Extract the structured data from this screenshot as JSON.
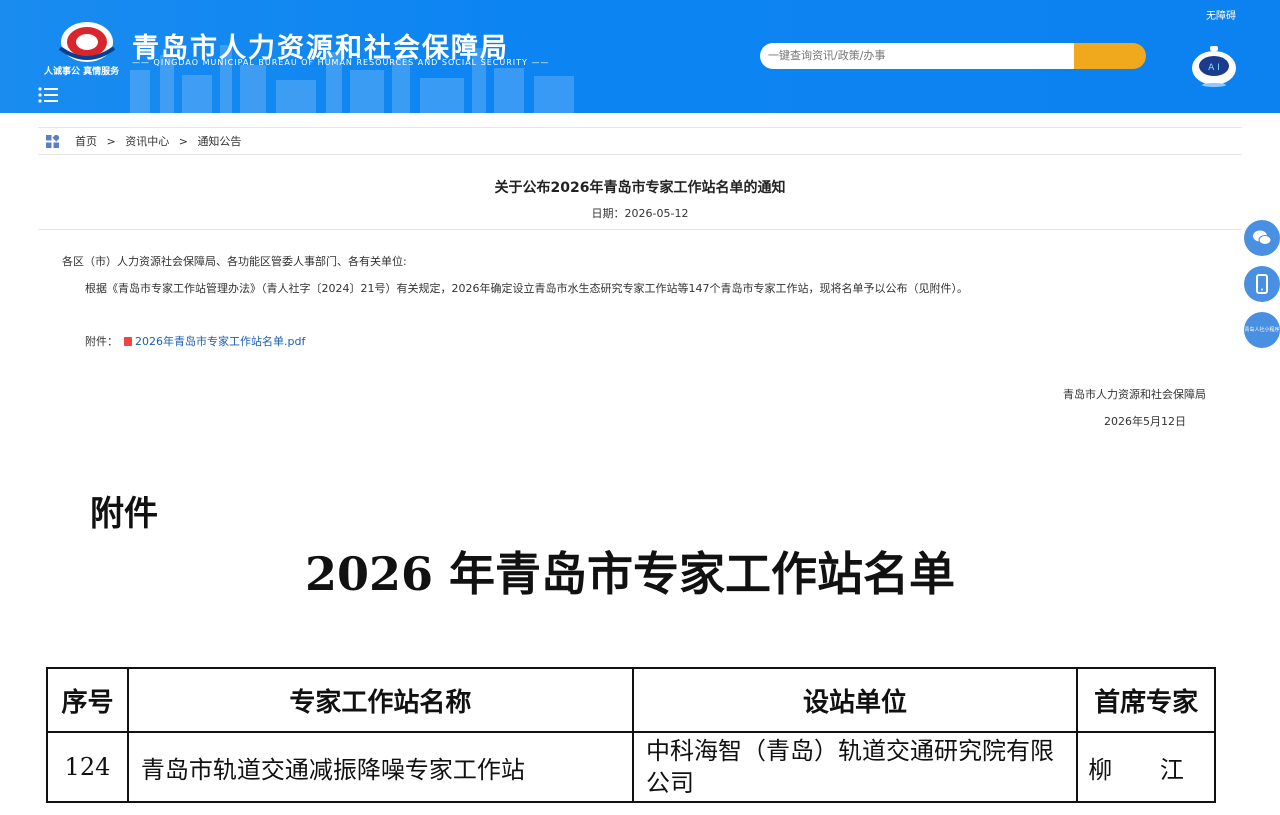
{
  "header": {
    "site_title": "青岛市人力资源和社会保障局",
    "site_subtitle": "—— QINGDAO MUNICIPAL BUREAU OF HUMAN RESOURCES AND SOCIAL SECURITY ——",
    "logo_slogan": "人诚事公 真情服务",
    "accessibility": "无障碍",
    "search_placeholder": "一键查询资讯/政策/办事"
  },
  "breadcrumb": [
    "首页",
    ">",
    "资讯中心",
    ">",
    "通知公告"
  ],
  "article": {
    "title": "关于公布2026年青岛市专家工作站名单的通知",
    "date": "日期：2026-05-12",
    "salutation": "各区（市）人力资源社会保障局、各功能区管委人事部门、各有关单位:",
    "paragraph": "根据《青岛市专家工作站管理办法》（青人社字〔2024〕21号）有关规定，2026年确定设立青岛市水生态研究专家工作站等147个青岛市专家工作站，现将名单予以公布（见附件）。",
    "attachment_label": "附件：",
    "attachment_link": "2026年青岛市专家工作站名单.pdf",
    "signer": "青岛市人力资源和社会保障局",
    "sign_date": "2026年5月12日"
  },
  "side_buttons": {
    "miniprogram": "青岛人社小程序"
  },
  "annex": {
    "label": "附件",
    "title": "2026 年青岛市专家工作站名单",
    "headers": [
      "序号",
      "专家工作站名称",
      "设站单位",
      "首席专家"
    ],
    "rows": [
      {
        "no": "124",
        "name": "青岛市轨道交通减振降噪专家工作站",
        "unit_line1": "中科海智（青岛）轨道交通研究院有限",
        "unit_line2": "公司",
        "expert": "柳 江"
      }
    ]
  },
  "colors": {
    "header_blue": "#0c84f2",
    "search_button": "#f0a81d",
    "link": "#1a5fb4",
    "side_button": "#4a90e2"
  }
}
